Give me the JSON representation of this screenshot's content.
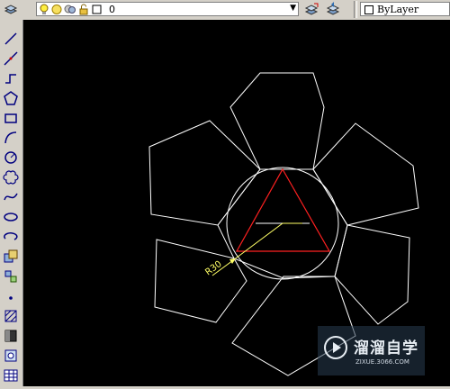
{
  "toolbar": {
    "layer_value": "0",
    "color_value": "ByLayer",
    "icons": [
      "layer-manager-icon",
      "lightbulb-icon",
      "sun-icon",
      "freeze-icon",
      "lock-icon",
      "color-square-icon",
      "make-current-icon",
      "layer-previous-icon"
    ]
  },
  "draw_tools": [
    "line-icon",
    "construction-line-icon",
    "polyline-icon",
    "polygon-icon",
    "rectangle-icon",
    "arc-icon",
    "circle-icon",
    "revision-cloud-icon",
    "spline-icon",
    "ellipse-icon",
    "ellipse-arc-icon",
    "insert-block-icon",
    "make-block-icon",
    "point-icon",
    "hatch-icon",
    "gradient-icon",
    "region-icon",
    "table-icon"
  ],
  "drawing": {
    "dimension_text": "R30",
    "colors": {
      "background": "#000000",
      "lines": "#ffffff",
      "triangle": "#ff2020",
      "dimension": "#ffff66"
    }
  },
  "watermark": {
    "title": "溜溜自学",
    "subtitle": "ZIXUE.3066.COM"
  }
}
